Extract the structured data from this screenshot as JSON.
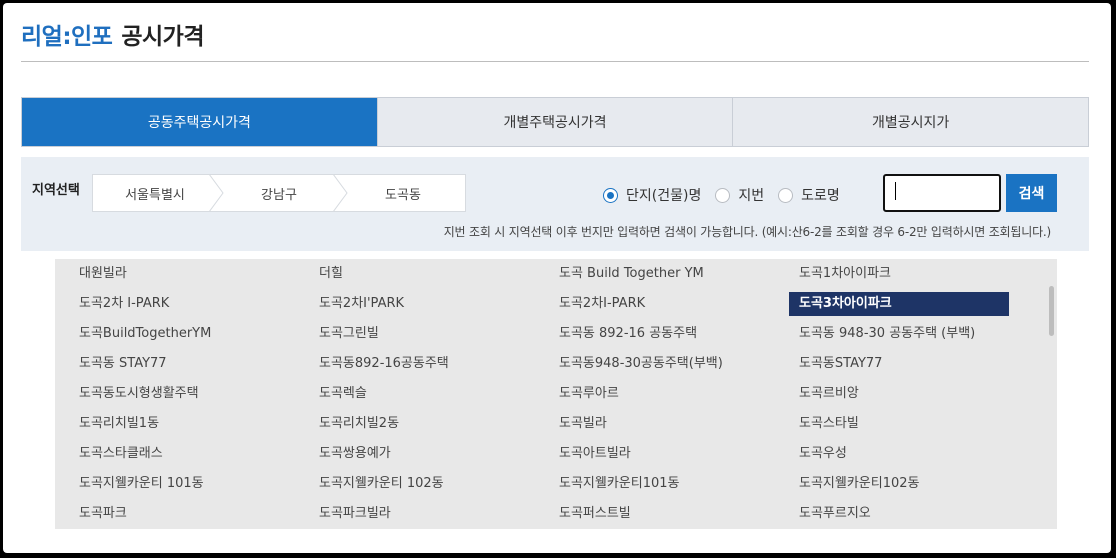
{
  "header": {
    "brand": "리얼:인포",
    "title": "공시가격"
  },
  "tabs": [
    {
      "label": "공동주택공시가격",
      "active": true
    },
    {
      "label": "개별주택공시가격",
      "active": false
    },
    {
      "label": "개별공시지가",
      "active": false
    }
  ],
  "region": {
    "label": "지역선택",
    "crumbs": [
      "서울특별시",
      "강남구",
      "도곡동"
    ]
  },
  "search": {
    "options": [
      {
        "label": "단지(건물)명",
        "selected": true
      },
      {
        "label": "지번",
        "selected": false
      },
      {
        "label": "도로명",
        "selected": false
      }
    ],
    "input_value": "",
    "button_label": "검색",
    "hint": "지번 조회 시 지역선택 이후 번지만 입력하면 검색이 가능합니다. (예시:산6-2를 조회할 경우 6-2만 입력하시면 조회됩니다.)"
  },
  "results": {
    "selected_item": "도곡3차아이파크",
    "rows": [
      [
        "대원빌라",
        "더힐",
        "도곡 Build Together YM",
        "도곡1차아이파크"
      ],
      [
        "도곡2차 I-PARK",
        "도곡2차I'PARK",
        "도곡2차I-PARK",
        "도곡3차아이파크"
      ],
      [
        "도곡BuildTogetherYM",
        "도곡그린빌",
        "도곡동 892-16 공동주택",
        "도곡동 948-30 공동주택 (부백)"
      ],
      [
        "도곡동 STAY77",
        "도곡동892-16공동주택",
        "도곡동948-30공동주택(부백)",
        "도곡동STAY77"
      ],
      [
        "도곡동도시형생활주택",
        "도곡렉슬",
        "도곡루아르",
        "도곡르비앙"
      ],
      [
        "도곡리치빌1동",
        "도곡리치빌2동",
        "도곡빌라",
        "도곡스타빌"
      ],
      [
        "도곡스타클래스",
        "도곡쌍용예가",
        "도곡아트빌라",
        "도곡우성"
      ],
      [
        "도곡지웰카운티 101동",
        "도곡지웰카운티 102동",
        "도곡지웰카운티101동",
        "도곡지웰카운티102동"
      ],
      [
        "도곡파크",
        "도곡파크빌라",
        "도곡퍼스트빌",
        "도곡푸르지오"
      ]
    ]
  },
  "colors": {
    "accent": "#1a73c3",
    "selected_bg": "#1e3466",
    "brand": "#1f6fbf"
  }
}
